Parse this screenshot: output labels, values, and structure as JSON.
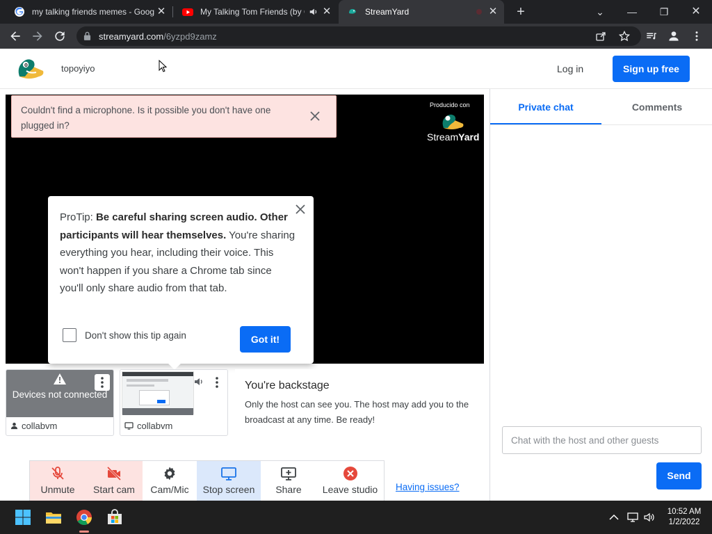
{
  "browser": {
    "tabs": [
      {
        "title": "my talking friends memes - Goog",
        "favicon": "google-icon",
        "active": false
      },
      {
        "title": "My Talking Tom Friends (by Ou",
        "favicon": "youtube-icon",
        "active": false,
        "audio": true
      },
      {
        "title": "StreamYard",
        "favicon": "streamyard-icon",
        "active": true
      }
    ],
    "new_tab_label": "+",
    "window_controls": [
      "chevron-down-icon",
      "minimize-icon",
      "restore-icon",
      "close-icon"
    ],
    "url_host": "streamyard.com",
    "url_path": "/6yzpd9zamz"
  },
  "header": {
    "username": "topoyiyo",
    "login_label": "Log in",
    "signup_label": "Sign up free",
    "accent_color": "#0a6cf5"
  },
  "stage": {
    "alert_text": "Couldn't find a microphone. Is it possible you don't have one plugged in?",
    "brand_caption": "Producido con",
    "brand_name_stream": "Stream",
    "brand_name_yard": "Yard"
  },
  "protip": {
    "prefix": "ProTip: ",
    "bold": "Be careful sharing screen audio. Other participants will hear themselves.",
    "body": " You're sharing everything you hear, including their voice. This won't happen if you share a Chrome tab since you'll only share audio from that tab.",
    "checkbox_label": "Don't show this tip again",
    "checkbox_checked": false,
    "button_label": "Got it!"
  },
  "participants": [
    {
      "status_line": "Devices not connected",
      "name": "collabvm",
      "type": "camera"
    },
    {
      "name": "collabvm",
      "type": "screen"
    }
  ],
  "backstage": {
    "title": "You're backstage",
    "text": "Only the host can see you. The host may add you to the broadcast at any time. Be ready!"
  },
  "controls": [
    {
      "label": "Unmute",
      "icon": "mic-off-icon",
      "state": "off"
    },
    {
      "label": "Start cam",
      "icon": "camera-off-icon",
      "state": "off"
    },
    {
      "label": "Cam/Mic",
      "icon": "gear-icon",
      "state": "neutral"
    },
    {
      "label": "Stop screen",
      "icon": "monitor-icon",
      "state": "active"
    },
    {
      "label": "Share",
      "icon": "share-screen-icon",
      "state": "neutral"
    },
    {
      "label": "Leave studio",
      "icon": "leave-icon",
      "state": "danger"
    }
  ],
  "having_issues": "Having issues?",
  "chat": {
    "tabs": [
      "Private chat",
      "Comments"
    ],
    "active_tab": "Private chat",
    "input_placeholder": "Chat with the host and other guests",
    "send_label": "Send"
  },
  "taskbar": {
    "time": "10:52 AM",
    "date": "1/2/2022",
    "apps": [
      "windows-start-icon",
      "file-explorer-icon",
      "chrome-icon",
      "store-icon"
    ]
  }
}
